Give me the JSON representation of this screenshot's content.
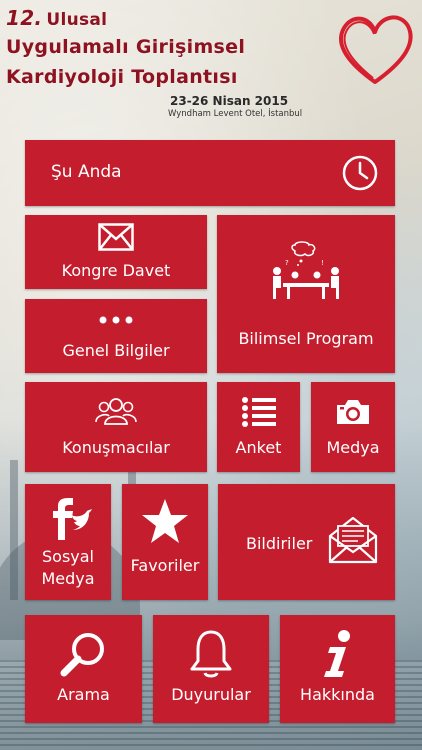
{
  "header": {
    "title_number": "12.",
    "title_line1": "Ulusal",
    "title_line2": "Uygulamalı Girişimsel",
    "title_line3": "Kardiyoloji Toplantısı",
    "date": "23-26 Nisan 2015",
    "venue": "Wyndham Levent Otel, İstanbul"
  },
  "colors": {
    "tile": "#c41e2e",
    "title": "#8e1220",
    "heart": "#d6202f"
  },
  "tiles": {
    "su_anda": {
      "label": "Şu Anda",
      "icon": "clock-icon"
    },
    "kongre_davet": {
      "label": "Kongre Davet",
      "icon": "envelope-icon"
    },
    "bilimsel_program": {
      "label": "Bilimsel Program",
      "icon": "meeting-icon"
    },
    "genel_bilgiler": {
      "label": "Genel Bilgiler",
      "icon": "dots-icon"
    },
    "konusmacilar": {
      "label": "Konuşmacılar",
      "icon": "people-icon"
    },
    "anket": {
      "label": "Anket",
      "icon": "list-icon"
    },
    "medya": {
      "label": "Medya",
      "icon": "camera-icon"
    },
    "sosyal_medya": {
      "label": "Sosyal Medya",
      "icon": "social-icon"
    },
    "favoriler": {
      "label": "Favoriler",
      "icon": "star-icon"
    },
    "bildiriler": {
      "label": "Bildiriler",
      "icon": "open-letter-icon"
    },
    "arama": {
      "label": "Arama",
      "icon": "search-icon"
    },
    "duyurular": {
      "label": "Duyurular",
      "icon": "bell-icon"
    },
    "hakkinda": {
      "label": "Hakkında",
      "icon": "info-icon"
    }
  }
}
